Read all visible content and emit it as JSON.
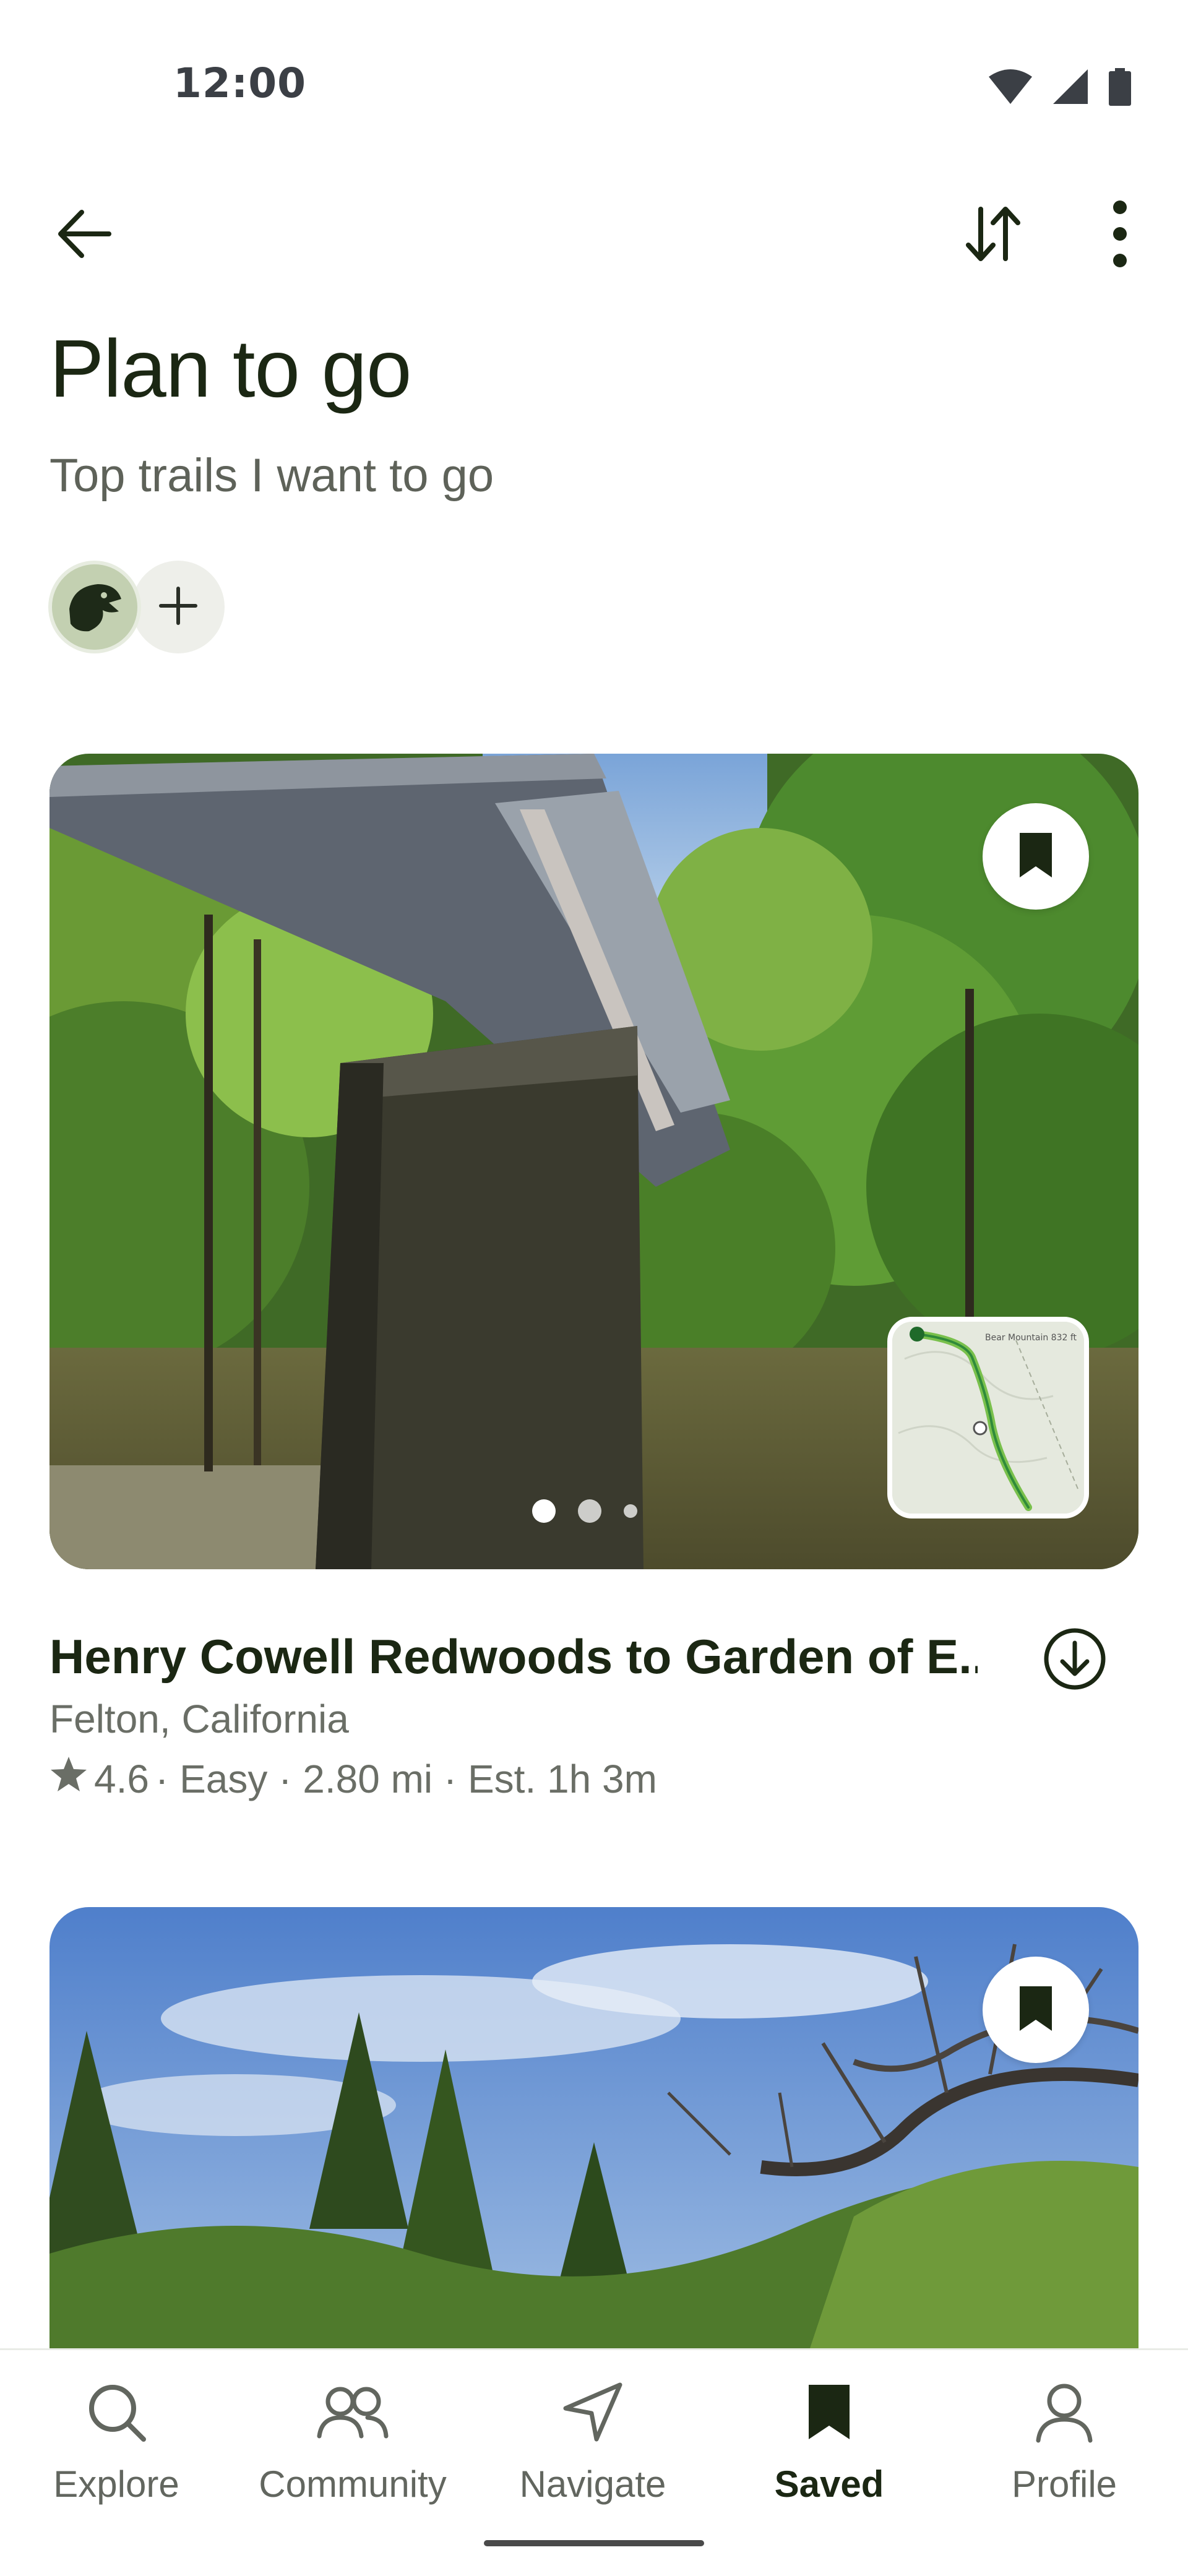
{
  "status_bar": {
    "time": "12:00",
    "icons": [
      "wifi-icon",
      "cellular-icon",
      "battery-icon"
    ]
  },
  "top_bar": {
    "back_icon": "arrow-left-icon",
    "sort_icon": "sort-arrows-icon",
    "more_icon": "more-vertical-icon"
  },
  "list": {
    "title": "Plan to go",
    "description": "Top trails I want to go",
    "collaborators": {
      "avatar_icon": "eagle-avatar-icon",
      "add_icon": "plus-icon"
    }
  },
  "trails": [
    {
      "name": "Henry Cowell Redwoods to Garden of E...",
      "location": "Felton, California",
      "rating": "4.6",
      "meta": "· Easy · 2.80 mi · Est. 1h 3m",
      "saved": true,
      "photo_count": 3,
      "active_photo": 1,
      "map_label": "Bear Mountain 832 ft"
    },
    {
      "saved": true
    }
  ],
  "bottom_nav": {
    "items": [
      {
        "label": "Explore",
        "icon": "search-icon",
        "active": false
      },
      {
        "label": "Community",
        "icon": "people-icon",
        "active": false
      },
      {
        "label": "Navigate",
        "icon": "navigation-arrow-icon",
        "active": false
      },
      {
        "label": "Saved",
        "icon": "bookmark-icon",
        "active": true
      },
      {
        "label": "Profile",
        "icon": "person-icon",
        "active": false
      }
    ]
  },
  "colors": {
    "primary_text": "#1b2713",
    "secondary_text": "#6a6e66",
    "accent": "#1b2713",
    "background": "#ffffff"
  }
}
